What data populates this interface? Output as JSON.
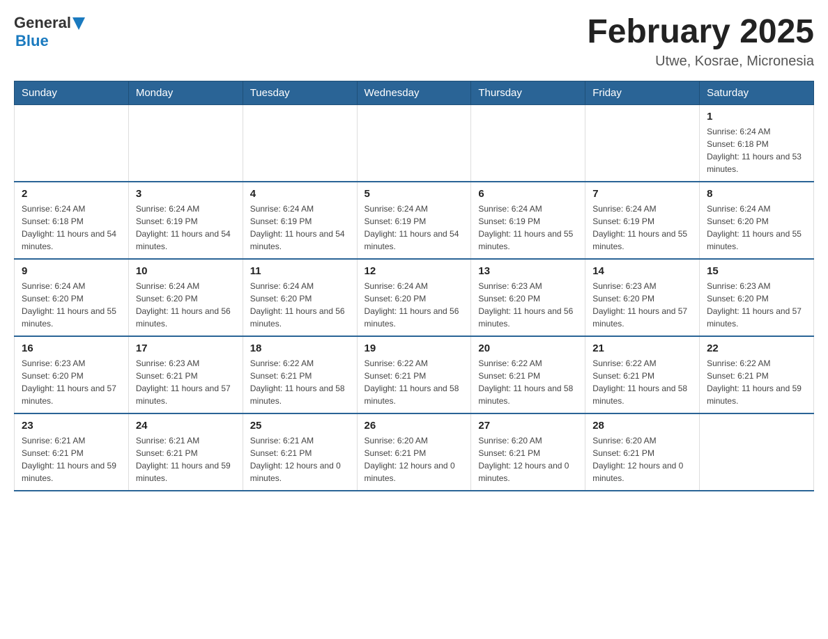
{
  "header": {
    "logo": {
      "general": "General",
      "blue": "Blue"
    },
    "title": "February 2025",
    "subtitle": "Utwe, Kosrae, Micronesia"
  },
  "calendar": {
    "weekdays": [
      "Sunday",
      "Monday",
      "Tuesday",
      "Wednesday",
      "Thursday",
      "Friday",
      "Saturday"
    ],
    "weeks": [
      [
        {
          "day": "",
          "info": ""
        },
        {
          "day": "",
          "info": ""
        },
        {
          "day": "",
          "info": ""
        },
        {
          "day": "",
          "info": ""
        },
        {
          "day": "",
          "info": ""
        },
        {
          "day": "",
          "info": ""
        },
        {
          "day": "1",
          "info": "Sunrise: 6:24 AM\nSunset: 6:18 PM\nDaylight: 11 hours and 53 minutes."
        }
      ],
      [
        {
          "day": "2",
          "info": "Sunrise: 6:24 AM\nSunset: 6:18 PM\nDaylight: 11 hours and 54 minutes."
        },
        {
          "day": "3",
          "info": "Sunrise: 6:24 AM\nSunset: 6:19 PM\nDaylight: 11 hours and 54 minutes."
        },
        {
          "day": "4",
          "info": "Sunrise: 6:24 AM\nSunset: 6:19 PM\nDaylight: 11 hours and 54 minutes."
        },
        {
          "day": "5",
          "info": "Sunrise: 6:24 AM\nSunset: 6:19 PM\nDaylight: 11 hours and 54 minutes."
        },
        {
          "day": "6",
          "info": "Sunrise: 6:24 AM\nSunset: 6:19 PM\nDaylight: 11 hours and 55 minutes."
        },
        {
          "day": "7",
          "info": "Sunrise: 6:24 AM\nSunset: 6:19 PM\nDaylight: 11 hours and 55 minutes."
        },
        {
          "day": "8",
          "info": "Sunrise: 6:24 AM\nSunset: 6:20 PM\nDaylight: 11 hours and 55 minutes."
        }
      ],
      [
        {
          "day": "9",
          "info": "Sunrise: 6:24 AM\nSunset: 6:20 PM\nDaylight: 11 hours and 55 minutes."
        },
        {
          "day": "10",
          "info": "Sunrise: 6:24 AM\nSunset: 6:20 PM\nDaylight: 11 hours and 56 minutes."
        },
        {
          "day": "11",
          "info": "Sunrise: 6:24 AM\nSunset: 6:20 PM\nDaylight: 11 hours and 56 minutes."
        },
        {
          "day": "12",
          "info": "Sunrise: 6:24 AM\nSunset: 6:20 PM\nDaylight: 11 hours and 56 minutes."
        },
        {
          "day": "13",
          "info": "Sunrise: 6:23 AM\nSunset: 6:20 PM\nDaylight: 11 hours and 56 minutes."
        },
        {
          "day": "14",
          "info": "Sunrise: 6:23 AM\nSunset: 6:20 PM\nDaylight: 11 hours and 57 minutes."
        },
        {
          "day": "15",
          "info": "Sunrise: 6:23 AM\nSunset: 6:20 PM\nDaylight: 11 hours and 57 minutes."
        }
      ],
      [
        {
          "day": "16",
          "info": "Sunrise: 6:23 AM\nSunset: 6:20 PM\nDaylight: 11 hours and 57 minutes."
        },
        {
          "day": "17",
          "info": "Sunrise: 6:23 AM\nSunset: 6:21 PM\nDaylight: 11 hours and 57 minutes."
        },
        {
          "day": "18",
          "info": "Sunrise: 6:22 AM\nSunset: 6:21 PM\nDaylight: 11 hours and 58 minutes."
        },
        {
          "day": "19",
          "info": "Sunrise: 6:22 AM\nSunset: 6:21 PM\nDaylight: 11 hours and 58 minutes."
        },
        {
          "day": "20",
          "info": "Sunrise: 6:22 AM\nSunset: 6:21 PM\nDaylight: 11 hours and 58 minutes."
        },
        {
          "day": "21",
          "info": "Sunrise: 6:22 AM\nSunset: 6:21 PM\nDaylight: 11 hours and 58 minutes."
        },
        {
          "day": "22",
          "info": "Sunrise: 6:22 AM\nSunset: 6:21 PM\nDaylight: 11 hours and 59 minutes."
        }
      ],
      [
        {
          "day": "23",
          "info": "Sunrise: 6:21 AM\nSunset: 6:21 PM\nDaylight: 11 hours and 59 minutes."
        },
        {
          "day": "24",
          "info": "Sunrise: 6:21 AM\nSunset: 6:21 PM\nDaylight: 11 hours and 59 minutes."
        },
        {
          "day": "25",
          "info": "Sunrise: 6:21 AM\nSunset: 6:21 PM\nDaylight: 12 hours and 0 minutes."
        },
        {
          "day": "26",
          "info": "Sunrise: 6:20 AM\nSunset: 6:21 PM\nDaylight: 12 hours and 0 minutes."
        },
        {
          "day": "27",
          "info": "Sunrise: 6:20 AM\nSunset: 6:21 PM\nDaylight: 12 hours and 0 minutes."
        },
        {
          "day": "28",
          "info": "Sunrise: 6:20 AM\nSunset: 6:21 PM\nDaylight: 12 hours and 0 minutes."
        },
        {
          "day": "",
          "info": ""
        }
      ]
    ]
  }
}
